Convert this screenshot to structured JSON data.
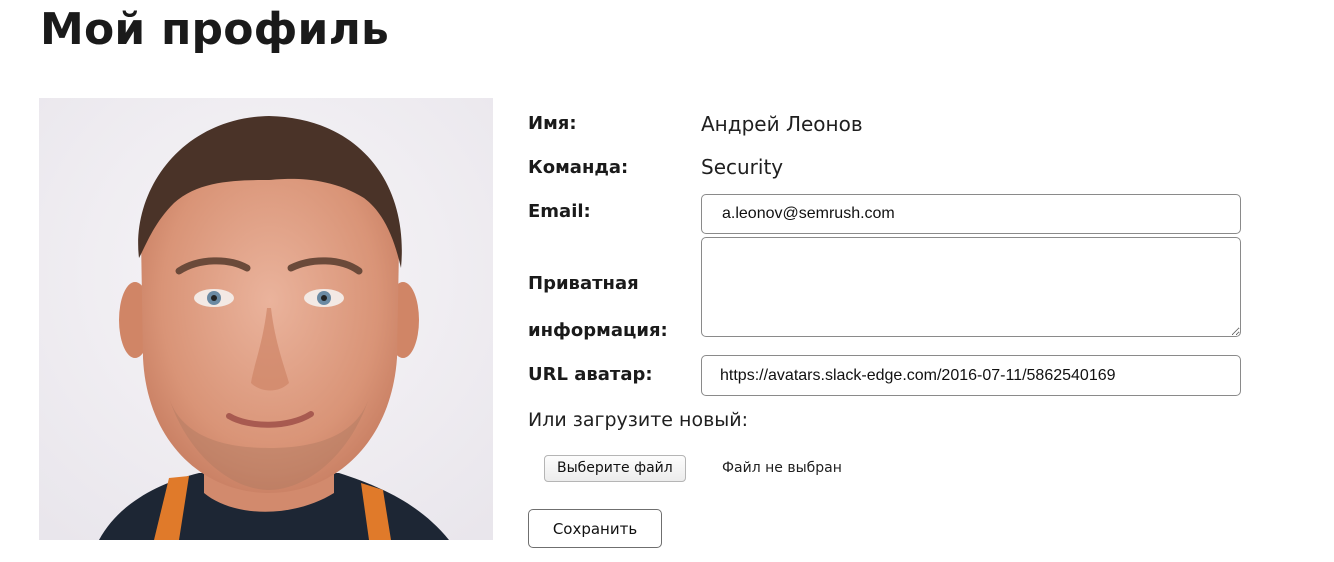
{
  "page": {
    "title": "Мой профиль"
  },
  "profile": {
    "name_label": "Имя:",
    "name_value": "Андрей Леонов",
    "team_label": "Команда:",
    "team_value": "Security",
    "email_label": "Email:",
    "email_value": "a.leonov@semrush.com",
    "private_label_line1": "Приватная",
    "private_label_line2": "информация:",
    "private_value": "",
    "avatar_url_label": "URL аватар:",
    "avatar_url_value": "https://avatars.slack-edge.com/2016-07-11/5862540169"
  },
  "upload": {
    "prompt": "Или загрузите новый:",
    "choose_file_label": "Выберите файл",
    "file_status": "Файл не выбран"
  },
  "actions": {
    "save_label": "Сохранить"
  },
  "colors": {
    "photo_background": "#f1eff3",
    "input_border": "#8a8a8a",
    "text": "#1a1a1a"
  }
}
